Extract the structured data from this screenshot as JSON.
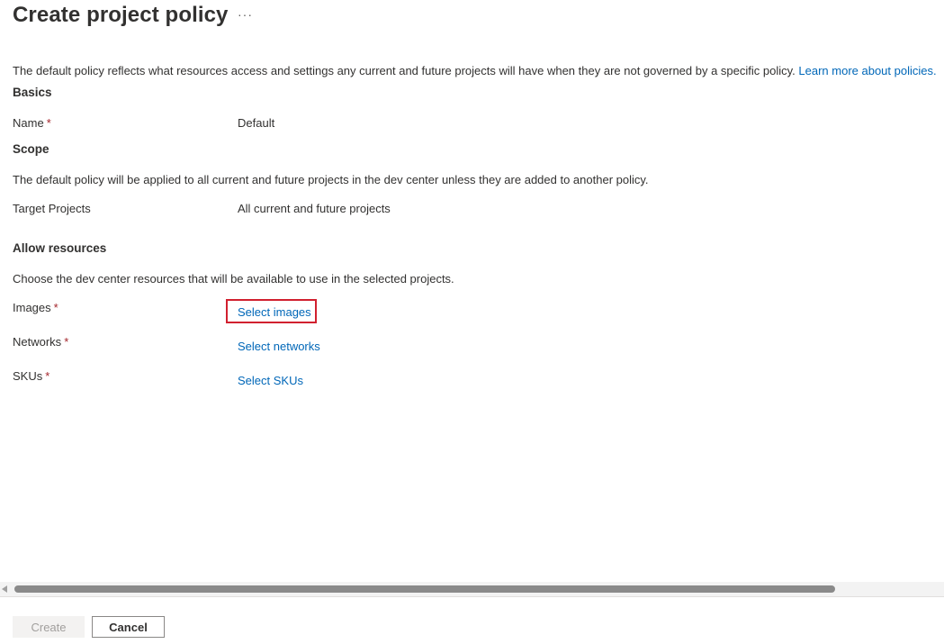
{
  "header": {
    "title": "Create project policy",
    "more_label": "···"
  },
  "intro": {
    "text": "The default policy reflects what resources access and settings any current and future projects will have when they are not governed by a specific policy.",
    "link": "Learn more about policies."
  },
  "basics": {
    "heading": "Basics",
    "name_label": "Name",
    "name_value": "Default",
    "required_mark": "*"
  },
  "scope": {
    "heading": "Scope",
    "description": "The default policy will be applied to all current and future projects in the dev center unless they are added to another policy.",
    "target_label": "Target Projects",
    "target_value": "All current and future projects"
  },
  "allow_resources": {
    "heading": "Allow resources",
    "description": "Choose the dev center resources that will be available to use in the selected projects.",
    "images_label": "Images",
    "images_link": "Select images",
    "networks_label": "Networks",
    "networks_link": "Select networks",
    "skus_label": "SKUs",
    "skus_link": "Select SKUs"
  },
  "footer": {
    "create_label": "Create",
    "cancel_label": "Cancel"
  },
  "colors": {
    "link": "#0067b8",
    "required": "#a4262c",
    "highlight": "#d1202f"
  }
}
